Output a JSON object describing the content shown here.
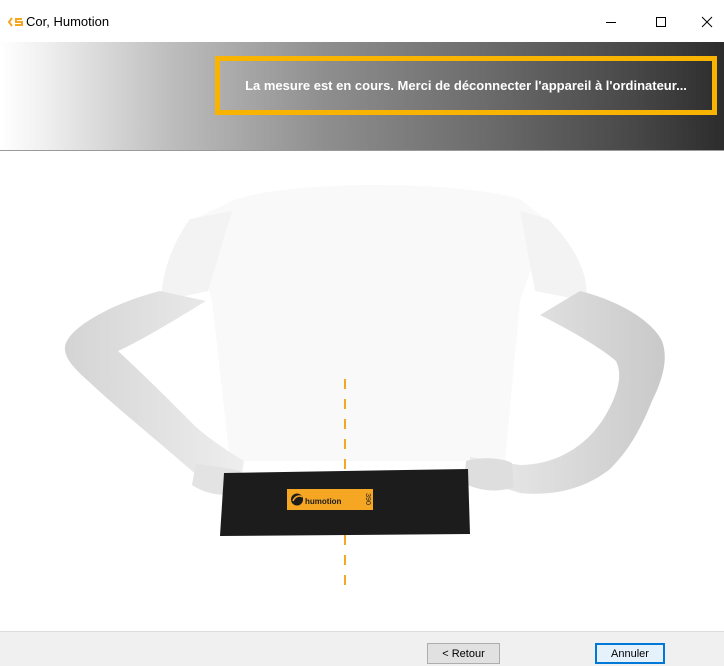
{
  "window": {
    "title": "Cor, Humotion",
    "app_icon": "cor-app-icon",
    "controls": {
      "minimize_icon": "minimize-icon",
      "maximize_icon": "maximize-icon",
      "close_icon": "close-icon"
    }
  },
  "banner": {
    "status_message": "La mesure est en cours. Merci de déconnecter l'appareil à l'ordinateur...",
    "highlight_color": "#f8b400"
  },
  "illustration": {
    "belt_brand": "humotion",
    "belt_code": "390",
    "accent_color": "#f5a623"
  },
  "footer": {
    "back_label": "< Retour",
    "cancel_label": "Annuler"
  }
}
